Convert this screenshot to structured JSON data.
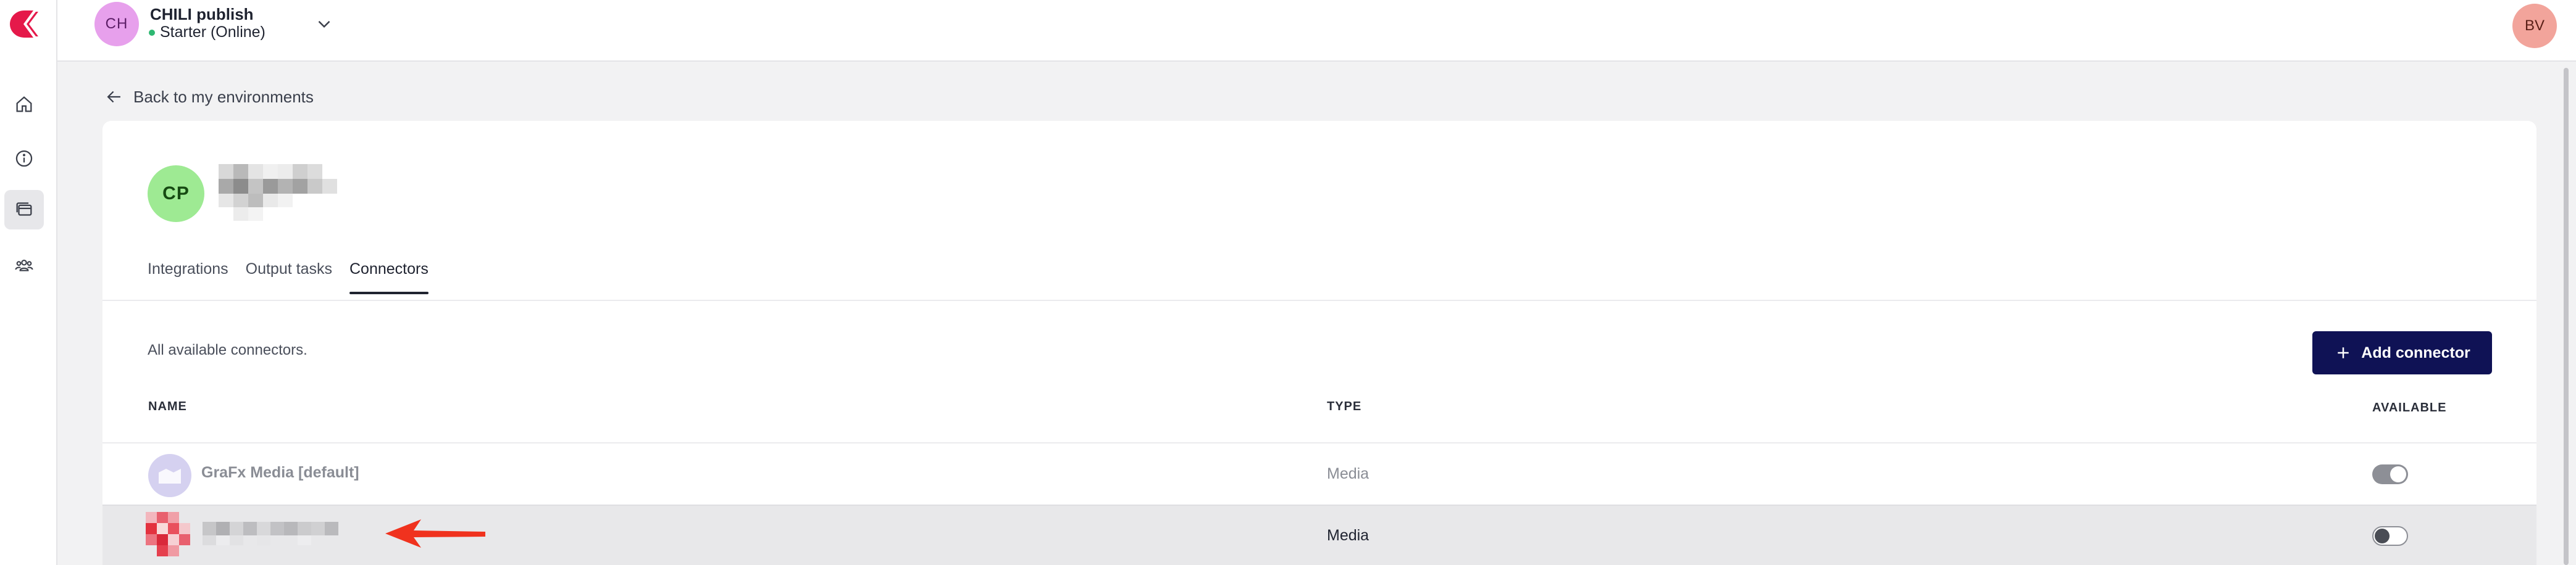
{
  "rail": {
    "items": [
      {
        "name": "home-icon",
        "active": false
      },
      {
        "name": "info-icon",
        "active": false
      },
      {
        "name": "environments-icon",
        "active": true
      },
      {
        "name": "users-icon",
        "active": false
      }
    ]
  },
  "topbar": {
    "org_initials": "CH",
    "org_name": "CHILI publish",
    "org_plan": "Starter (Online)",
    "user_initials": "BV"
  },
  "back_link": "Back to my environments",
  "environment": {
    "initials": "CP"
  },
  "tabs": [
    {
      "label": "Integrations",
      "active": false
    },
    {
      "label": "Output tasks",
      "active": false
    },
    {
      "label": "Connectors",
      "active": true
    }
  ],
  "connectors": {
    "description": "All available connectors.",
    "add_button_label": "Add connector",
    "columns": {
      "name": "NAME",
      "type": "TYPE",
      "available": "AVAILABLE"
    },
    "rows": [
      {
        "name": "GraFx Media [default]",
        "type": "Media",
        "available": true
      },
      {
        "name": "",
        "type": "Media",
        "available": false
      }
    ]
  },
  "colors": {
    "brand_logo": "#e5194a",
    "primary_button": "#0f1255",
    "status_online": "#2eb872",
    "annotation_arrow": "#f0321e"
  }
}
